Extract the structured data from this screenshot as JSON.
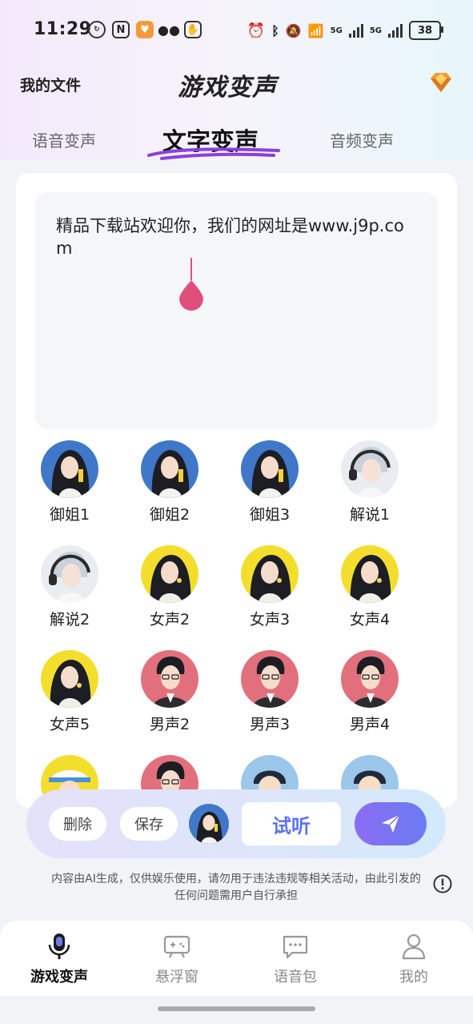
{
  "status_bar": {
    "time": "11:29",
    "battery": "38",
    "net_label_1": "5G",
    "net_label_2": "5G"
  },
  "header": {
    "my_files": "我的文件",
    "title": "游戏变声",
    "vip_icon": "diamond-icon"
  },
  "tabs": [
    {
      "label": "语音变声",
      "active": false
    },
    {
      "label": "文字变声",
      "active": true
    },
    {
      "label": "音频变声",
      "active": false
    }
  ],
  "editor": {
    "text": "精品下载站欢迎你，我们的网址是www.j9p.com"
  },
  "voices": [
    {
      "label": "御姐1",
      "style": "blue-girl"
    },
    {
      "label": "御姐2",
      "style": "blue-girl"
    },
    {
      "label": "御姐3",
      "style": "blue-girl"
    },
    {
      "label": "解说1",
      "style": "headphone-boy"
    },
    {
      "label": "解说2",
      "style": "headphone-boy"
    },
    {
      "label": "女声2",
      "style": "yellow-girl"
    },
    {
      "label": "女声3",
      "style": "yellow-girl"
    },
    {
      "label": "女声4",
      "style": "yellow-girl"
    },
    {
      "label": "女声5",
      "style": "yellow-girl"
    },
    {
      "label": "男声2",
      "style": "pink-man"
    },
    {
      "label": "男声3",
      "style": "pink-man"
    },
    {
      "label": "男声4",
      "style": "pink-man"
    }
  ],
  "action_bar": {
    "delete": "删除",
    "save": "保存",
    "listen": "试听",
    "send_icon": "send-icon"
  },
  "disclaimer": "内容由AI生成，仅供娱乐使用，请勿用于违法违规等相关活动，由此引发的任何问题需用户自行承担",
  "bottom_nav": [
    {
      "label": "游戏变声",
      "icon": "microphone-icon",
      "active": true
    },
    {
      "label": "悬浮窗",
      "icon": "gamepad-icon",
      "active": false
    },
    {
      "label": "语音包",
      "icon": "chat-icon",
      "active": false
    },
    {
      "label": "我的",
      "icon": "user-icon",
      "active": false
    }
  ],
  "colors": {
    "accent": "#6a7cf2",
    "caret": "#e04f7b",
    "tab_underline": "#8a3fe0"
  }
}
